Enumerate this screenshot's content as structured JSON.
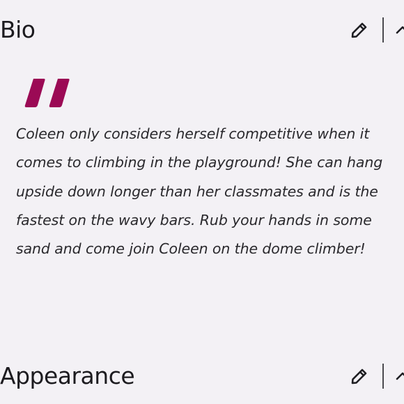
{
  "bio_section": {
    "title": "Bio",
    "edit_icon": "pencil-icon",
    "collapse_icon": "chevron-up-icon",
    "quote_icon": "quote-icon",
    "quote_color": "#9b0a55",
    "text_lines": [
      "Coleen only considers herself competitive when it",
      "comes to climbing in the playground! She can hang",
      "upside down longer than her classmates and is the",
      "fastest on the wavy bars. Rub your hands in some",
      "sand and come join Coleen on the dome climber!"
    ]
  },
  "appearance_section": {
    "title": "Appearance",
    "edit_icon": "pencil-icon",
    "collapse_icon": "chevron-up-icon"
  },
  "colors": {
    "background": "#f3f1f5",
    "text": "#1c1b1f",
    "accent": "#9b0a55"
  }
}
